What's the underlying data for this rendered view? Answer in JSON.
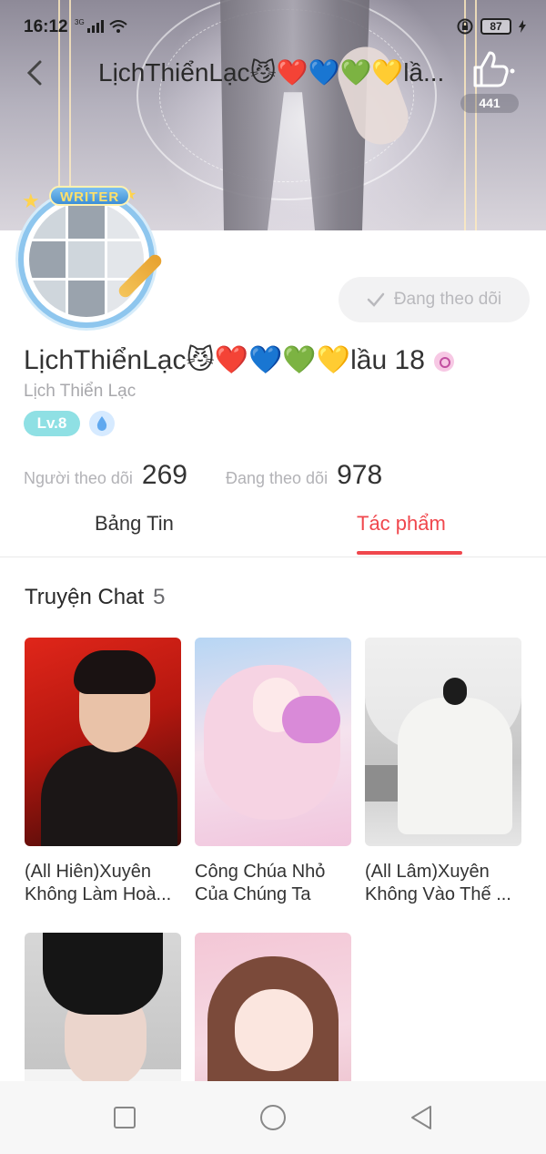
{
  "status_bar": {
    "time": "16:12",
    "network": "3G",
    "battery": "87"
  },
  "nav": {
    "title": "LịchThiểnLạc😼❤️💙💚💛lầ...",
    "like_count": "441"
  },
  "avatar": {
    "badge": "WRITER"
  },
  "follow_button": {
    "label": "Đang theo dõi"
  },
  "profile": {
    "display_name": "LịchThiểnLạc😼❤️💙💚💛lầu 18",
    "username": "Lịch Thiển Lạc",
    "level": "Lv.8"
  },
  "stats": {
    "followers_label": "Người theo dõi",
    "followers_value": "269",
    "following_label": "Đang theo dõi",
    "following_value": "978"
  },
  "tabs": {
    "feed": "Bảng Tin",
    "works": "Tác phẩm"
  },
  "section": {
    "title": "Truyện Chat",
    "count": "5"
  },
  "stories": [
    {
      "title": "(All Hiên)Xuyên Không Làm Hoà..."
    },
    {
      "title": "Công Chúa Nhỏ Của Chúng Ta"
    },
    {
      "title": "(All Lâm)Xuyên Không Vào Thế ..."
    },
    {
      "title": ""
    },
    {
      "title": ""
    }
  ],
  "colors": {
    "accent": "#f0474d",
    "level_badge": "#8fe0e4",
    "follow_bg": "#f2f2f3"
  }
}
